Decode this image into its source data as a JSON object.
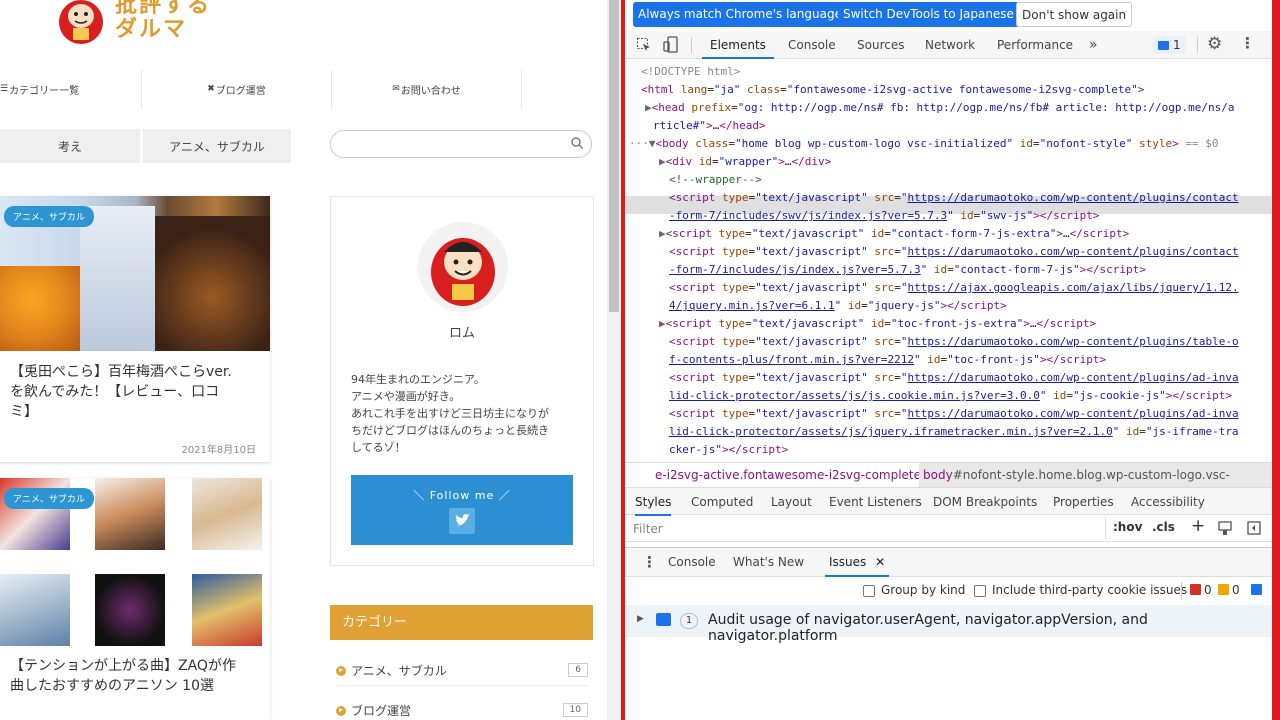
{
  "site": {
    "logo_line1": "批評する",
    "logo_line2": "ダルマ",
    "nav": [
      "カテゴリー一覧",
      "ブログ運営",
      "お問い合わせ"
    ],
    "tabs": [
      "考え",
      "アニメ、サブカル"
    ],
    "post1": {
      "badge": "アニメ、サブカル",
      "title_l1": "【兎田ぺこら】百年梅酒ぺこらver.",
      "title_l2": "を飲んでみた！【レビュー、口コ",
      "title_l3": "ミ】",
      "date": "2021年8月10日"
    },
    "post2": {
      "badge": "アニメ、サブカル",
      "title_l1": "【テンションが上がる曲】ZAQが作",
      "title_l2": "曲したおすすめのアニソン 10選"
    },
    "profile": {
      "name": "ロム",
      "bio1": "94年生まれのエンジニア。",
      "bio2": "アニメや漫画が好き。",
      "bio3": "あれこれ手を出すけど三日坊主になりが",
      "bio4": "ちだけどブログはほんのちょっと長続き",
      "bio5": "してるゾ！",
      "follow": "＼ Follow me ／"
    },
    "category_head": "カテゴリー",
    "categories": [
      {
        "label": "アニメ、サブカル",
        "count": "6"
      },
      {
        "label": "ブログ運営",
        "count": "10"
      }
    ]
  },
  "devtools": {
    "infobar": {
      "btn1": "Always match Chrome's language",
      "btn2": "Switch DevTools to Japanese",
      "btn3": "Don't show again"
    },
    "tabs": [
      "Elements",
      "Console",
      "Sources",
      "Network",
      "Performance"
    ],
    "more": "»",
    "issues_count": "1",
    "breadcrumb_left": "e-i2svg-active.fontawesome-i2svg-complete",
    "breadcrumb_right_tag": "body",
    "breadcrumb_right": "#nofont-style.home.blog.wp-custom-logo.vsc-initialized",
    "style_tabs": [
      "Styles",
      "Computed",
      "Layout",
      "Event Listeners",
      "DOM Breakpoints",
      "Properties",
      "Accessibility"
    ],
    "filter_placeholder": "Filter",
    "hov": ":hov",
    "cls": ".cls",
    "drawer_tabs": [
      "Console",
      "What's New",
      "Issues"
    ],
    "group_by_kind": "Group by kind",
    "third_party": "Include third-party cookie issues",
    "err_count": "0",
    "warn_count": "0",
    "issue_count_badge": "1",
    "issue_text": "Audit usage of navigator.userAgent, navigator.appVersion, and navigator.platform"
  },
  "colors": {
    "accent_orange": "#e0a135",
    "devtools_blue": "#1a73e8",
    "frame_red": "#e2181f",
    "badge_blue": "#2e95d3"
  }
}
